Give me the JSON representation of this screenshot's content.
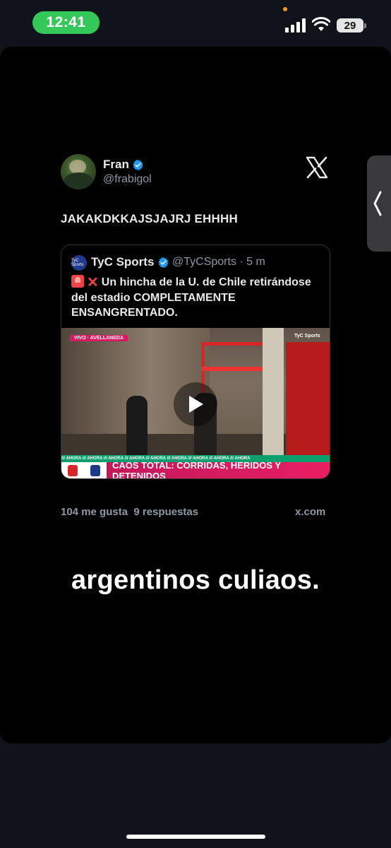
{
  "status_bar": {
    "time": "12:41",
    "battery": "29"
  },
  "tweet": {
    "name": "Fran",
    "handle": "@frabigol",
    "text": "JAKAKDKKAJSJAJRJ EHHHH",
    "stats_likes": "104 me gusta",
    "stats_replies": "9 respuestas",
    "source": "x.com"
  },
  "quote": {
    "avatar_text": "TyC Sports",
    "name": "TyC Sports",
    "handle": "@TyCSports · 5 m",
    "text": "Un hincha de la U. de Chile retirándose del estadio COMPLETAMENTE ENSANGRENTADO.",
    "video": {
      "live_tag": "VIVO · AVELLANEDA",
      "bug": "TyC Sports",
      "ticker": "/// AHORA /// AHORA /// AHORA /// AHORA /// AHORA /// AHORA /// AHORA /// AHORA /// AHORA",
      "caption": "CAOS TOTAL: CORRIDAS, HERIDOS Y DETENIDOS"
    }
  },
  "overlay": {
    "text": "argentinos culiaos."
  },
  "icons": {
    "verified": "verified-badge-icon",
    "x_logo": "x-logo-icon",
    "play": "play-icon",
    "chevron": "chevron-left-icon"
  },
  "colors": {
    "status_pill": "#34c759",
    "verified": "#1d9bf0",
    "caption_bar": "#e91e63"
  }
}
